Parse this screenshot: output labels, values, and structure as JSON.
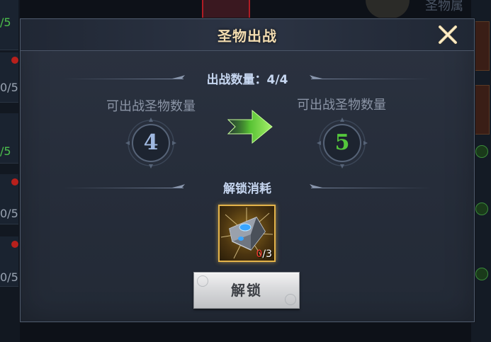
{
  "background": {
    "left_fractions": [
      "/5",
      "0/5",
      "/5",
      "0/5",
      "0/5"
    ],
    "top_right_text": "圣物属"
  },
  "dialog": {
    "title": "圣物出战",
    "deploy_count_label": "出战数量：4/4",
    "current_slot_label": "可出战圣物数量",
    "current_slot_value": "4",
    "next_slot_label": "可出战圣物数量",
    "next_slot_value": "5",
    "unlock_cost_label": "解锁消耗",
    "cost_item": {
      "icon": "relic-stone-icon",
      "have": "0",
      "need": "/3"
    },
    "unlock_button_label": "解锁"
  },
  "colors": {
    "title": "#f2dcb0",
    "current_value": "#9fb8e0",
    "next_value": "#54c63c",
    "arrow": "#6fd93c",
    "item_border": "#e3b34a",
    "insufficient": "#ff3b30"
  }
}
